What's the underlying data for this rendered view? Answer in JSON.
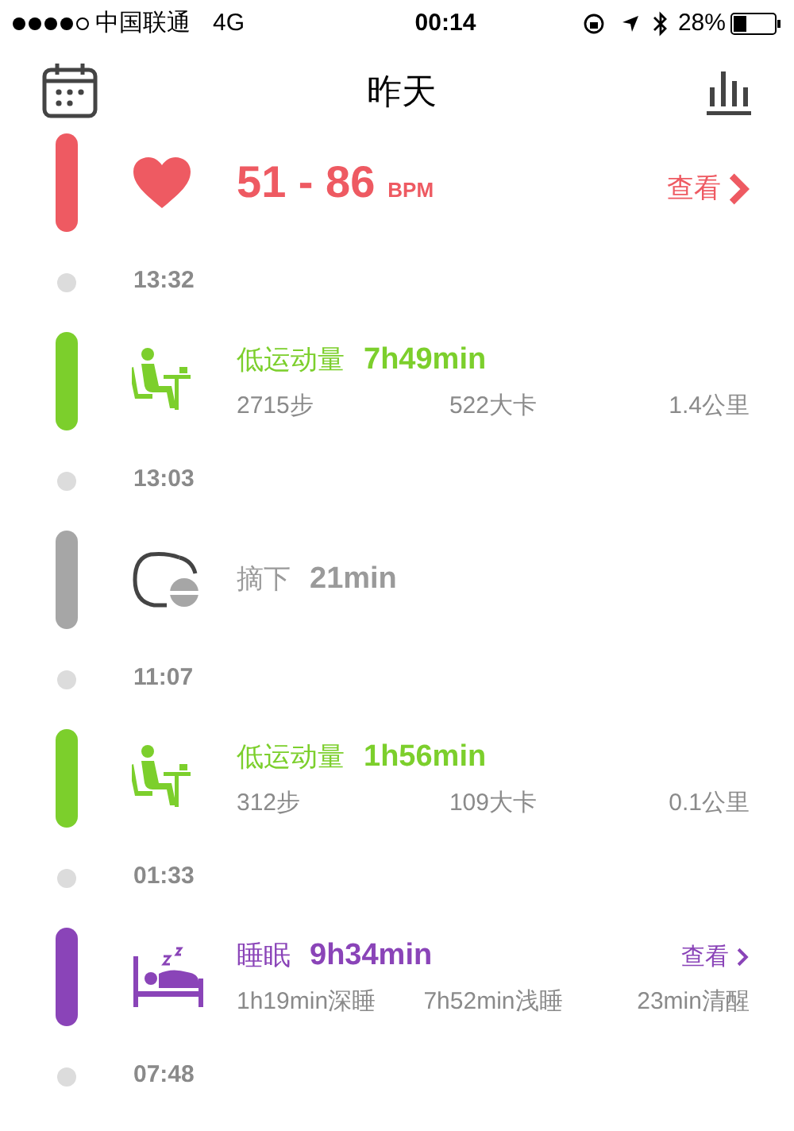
{
  "status_bar": {
    "carrier": "中国联通",
    "network": "4G",
    "time": "00:14",
    "battery": "28%"
  },
  "header": {
    "title": "昨天"
  },
  "timeline": [
    {
      "kind": "heart",
      "color": "#ee5a62",
      "value": "51 - 86",
      "unit": "BPM",
      "link": "查看"
    },
    {
      "kind": "time",
      "time": "13:32"
    },
    {
      "kind": "activity",
      "color": "#7ccf2c",
      "title": "低运动量",
      "value": "7h49min",
      "stats": [
        "2715步",
        "522大卡",
        "1.4公里"
      ]
    },
    {
      "kind": "time",
      "time": "13:03"
    },
    {
      "kind": "off",
      "color": "#a6a6a6",
      "title": "摘下",
      "value": "21min"
    },
    {
      "kind": "time",
      "time": "11:07"
    },
    {
      "kind": "activity",
      "color": "#7ccf2c",
      "title": "低运动量",
      "value": "1h56min",
      "stats": [
        "312步",
        "109大卡",
        "0.1公里"
      ]
    },
    {
      "kind": "time",
      "time": "01:33"
    },
    {
      "kind": "sleep",
      "color": "#8a44b8",
      "title": "睡眠",
      "value": "9h34min",
      "link": "查看",
      "stats": [
        "1h19min深睡",
        "7h52min浅睡",
        "23min清醒"
      ]
    },
    {
      "kind": "time",
      "time": "07:48"
    }
  ]
}
